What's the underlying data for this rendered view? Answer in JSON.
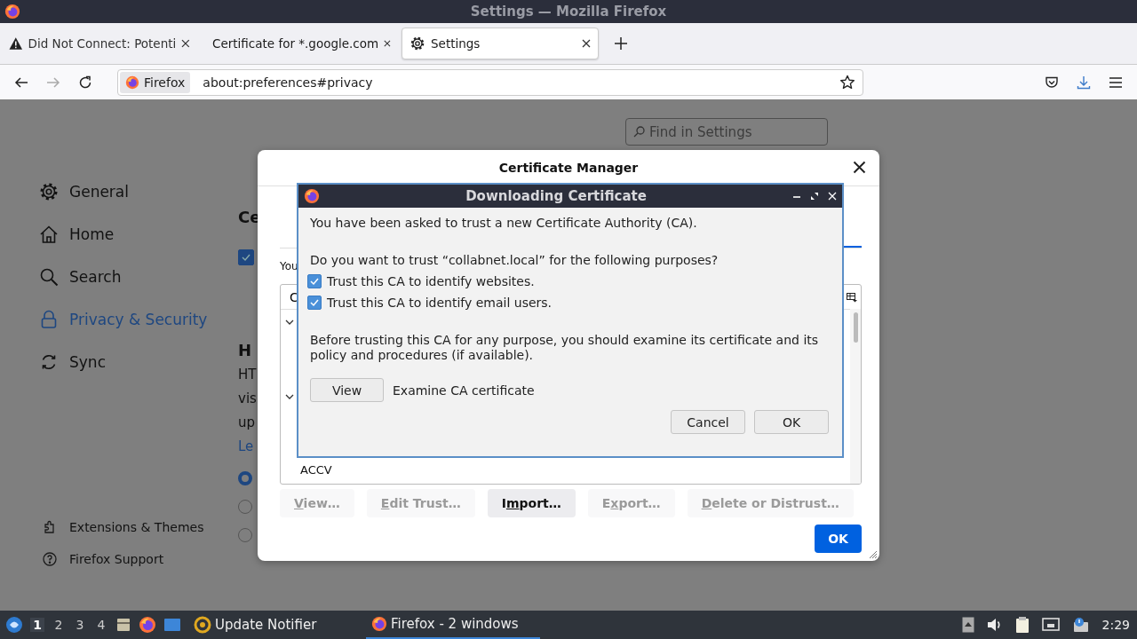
{
  "window": {
    "title": "Settings — Mozilla Firefox"
  },
  "tabs": [
    {
      "label": "Did Not Connect: Potenti",
      "kind": "warning",
      "selected": false
    },
    {
      "label": "Certificate for *.google.com",
      "kind": "page",
      "selected": false
    },
    {
      "label": "Settings",
      "kind": "settings",
      "selected": true
    }
  ],
  "toolbar": {
    "identity": "Firefox",
    "url": "about:preferences#privacy",
    "forward_disabled": true
  },
  "settings": {
    "search": {
      "placeholder": "Find in Settings"
    },
    "nav": [
      {
        "label": "General",
        "selected": false
      },
      {
        "label": "Home",
        "selected": false
      },
      {
        "label": "Search",
        "selected": false
      },
      {
        "label": "Privacy & Security",
        "selected": true
      },
      {
        "label": "Sync",
        "selected": false
      }
    ],
    "footer": [
      "Extensions & Themes",
      "Firefox Support"
    ],
    "content": {
      "heading_1": "Ce",
      "checkbox_checked": true,
      "heading_2": "H",
      "lines": [
        "HT",
        "vis",
        "up"
      ],
      "link": "Le",
      "radios": [
        {
          "selected": true
        },
        {
          "selected": false
        },
        {
          "selected": false
        }
      ]
    }
  },
  "certificate_manager": {
    "title": "Certificate Manager",
    "intro": "You",
    "table": {
      "column_1": "C",
      "rows": [
        {
          "kind": "group",
          "expanded": true
        },
        {
          "kind": "item"
        },
        {
          "kind": "item"
        },
        {
          "kind": "group",
          "expanded": true
        },
        {
          "kind": "item"
        },
        {
          "kind": "item"
        }
      ],
      "partial_row": "ACCV"
    },
    "buttons": [
      {
        "label": [
          {
            "text": "V",
            "underlined": true
          },
          {
            "text": "iew…",
            "underlined": false
          }
        ],
        "disabled": true
      },
      {
        "label": [
          {
            "text": "E",
            "underlined": true
          },
          {
            "text": "dit Trust…",
            "underlined": false
          }
        ],
        "disabled": true
      },
      {
        "label": [
          {
            "text": "I",
            "underlined": false
          },
          {
            "text": "m",
            "underlined": true
          },
          {
            "text": "port…",
            "underlined": false
          }
        ],
        "disabled": false
      },
      {
        "label": [
          {
            "text": "E",
            "underlined": false
          },
          {
            "text": "x",
            "underlined": true
          },
          {
            "text": "port…",
            "underlined": false
          }
        ],
        "disabled": true
      },
      {
        "label": [
          {
            "text": "D",
            "underlined": true
          },
          {
            "text": "elete or Distrust…",
            "underlined": false
          }
        ],
        "disabled": true
      }
    ],
    "ok": "OK"
  },
  "download_dialog": {
    "title": "Downloading Certificate",
    "message": "You have been asked to trust a new Certificate Authority (CA).",
    "question": "Do you want to trust “collabnet.local” for the following purposes?",
    "options": [
      {
        "label": "Trust this CA to identify websites.",
        "checked": true
      },
      {
        "label": "Trust this CA to identify email users.",
        "checked": true
      }
    ],
    "note": "Before trusting this CA for any purpose, you should examine its certificate and its policy and procedures (if available).",
    "view_button": "View",
    "view_label": "Examine CA certificate",
    "buttons": [
      "Cancel",
      "OK"
    ]
  },
  "taskbar": {
    "workspaces": [
      {
        "label": "1",
        "selected": true
      },
      {
        "label": "2",
        "selected": false
      },
      {
        "label": "3",
        "selected": false
      },
      {
        "label": "4",
        "selected": false
      }
    ],
    "tasks": [
      {
        "label": "Update Notifier",
        "kind": "notifier",
        "selected": false
      },
      {
        "label": "Firefox - 2 windows",
        "kind": "firefox",
        "selected": true
      }
    ],
    "clock": "2:29"
  }
}
